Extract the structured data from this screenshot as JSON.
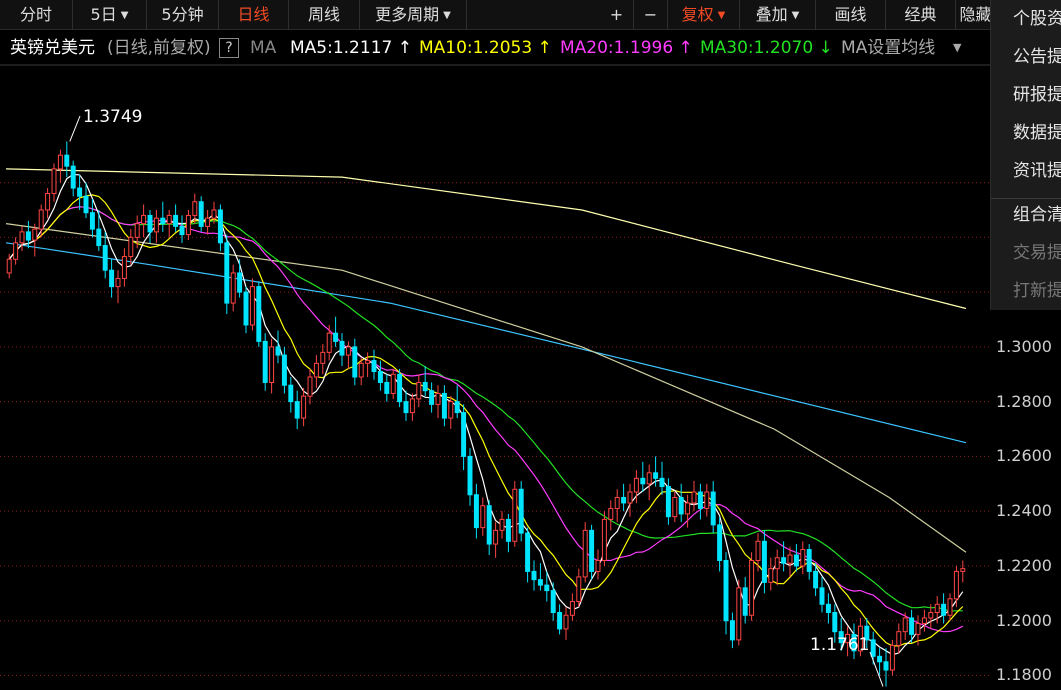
{
  "toolbar": {
    "left_buttons": [
      {
        "label": "分时",
        "x": 0,
        "w": 73,
        "active": false,
        "caret": false
      },
      {
        "label": "5日",
        "x": 73,
        "w": 74,
        "active": false,
        "caret": true
      },
      {
        "label": "5分钟",
        "x": 147,
        "w": 72,
        "active": false,
        "caret": false
      },
      {
        "label": "日线",
        "x": 219,
        "w": 70,
        "active": true,
        "caret": false
      },
      {
        "label": "周线",
        "x": 289,
        "w": 71,
        "active": false,
        "caret": false
      },
      {
        "label": "更多周期",
        "x": 360,
        "w": 107,
        "active": false,
        "caret": true
      }
    ],
    "right_buttons": [
      {
        "label": "+",
        "x": 600,
        "w": 34,
        "active": false,
        "caret": false
      },
      {
        "label": "−",
        "x": 634,
        "w": 34,
        "active": false,
        "caret": false
      },
      {
        "label": "复权",
        "x": 668,
        "w": 72,
        "active": true,
        "caret": true
      },
      {
        "label": "叠加",
        "x": 740,
        "w": 76,
        "active": false,
        "caret": true
      },
      {
        "label": "画线",
        "x": 816,
        "w": 70,
        "active": false,
        "caret": false
      },
      {
        "label": "经典",
        "x": 886,
        "w": 70,
        "active": false,
        "caret": false
      },
      {
        "label": "隐藏",
        "x": 956,
        "w": 40,
        "active": false,
        "caret": false
      }
    ]
  },
  "legend": {
    "title": "英镑兑美元",
    "subtitle": "(日线,前复权)",
    "help": "?",
    "ma_label": "MA",
    "items": [
      {
        "text": "MA5:1.2117",
        "arrow": "↑",
        "color": "#ffffff"
      },
      {
        "text": "MA10:1.2053",
        "arrow": "↑",
        "color": "#ffff00"
      },
      {
        "text": "MA20:1.1996",
        "arrow": "↑",
        "color": "#ff3cff"
      },
      {
        "text": "MA30:1.2070",
        "arrow": "↓",
        "color": "#22e022"
      }
    ],
    "settings": "MA设置均线"
  },
  "side_menu": {
    "items": [
      {
        "label": "个股资",
        "disabled": false
      },
      {
        "label": "公告提",
        "disabled": false
      },
      {
        "label": "研报提",
        "disabled": false
      },
      {
        "label": "数据提",
        "disabled": false
      },
      {
        "label": "资讯提",
        "disabled": false
      },
      {
        "label": "组合清",
        "disabled": false
      },
      {
        "label": "交易提",
        "disabled": true
      },
      {
        "label": "打新提",
        "disabled": true
      }
    ]
  },
  "colors": {
    "up": "#ff4545",
    "down": "#00e5ff",
    "ma5": "#ffffff",
    "ma10": "#ffff00",
    "ma20": "#ff3cff",
    "ma30": "#22e022",
    "ma60": "#cfcfa0",
    "ma120": "#3bc4ff",
    "ma250": "#ffffb0",
    "grid": "#8b1f1f"
  },
  "chart_data": {
    "type": "candlestick",
    "title": "英镑兑美元",
    "ylim": [
      1.1747,
      1.4033
    ],
    "yticks": [
      1.3,
      1.28,
      1.26,
      1.24,
      1.22,
      1.2,
      1.18
    ],
    "annotations": {
      "high": "1.3749",
      "low": "1.1761"
    },
    "candles": [
      [
        1.327,
        1.334,
        1.325,
        1.332
      ],
      [
        1.332,
        1.34,
        1.33,
        1.338
      ],
      [
        1.338,
        1.344,
        1.335,
        1.342
      ],
      [
        1.342,
        1.346,
        1.336,
        1.339
      ],
      [
        1.339,
        1.345,
        1.333,
        1.343
      ],
      [
        1.343,
        1.352,
        1.34,
        1.35
      ],
      [
        1.35,
        1.358,
        1.347,
        1.356
      ],
      [
        1.356,
        1.367,
        1.353,
        1.365
      ],
      [
        1.365,
        1.372,
        1.36,
        1.37
      ],
      [
        1.37,
        1.375,
        1.362,
        1.366
      ],
      [
        1.366,
        1.368,
        1.355,
        1.358
      ],
      [
        1.358,
        1.363,
        1.35,
        1.355
      ],
      [
        1.355,
        1.36,
        1.347,
        1.349
      ],
      [
        1.349,
        1.354,
        1.34,
        1.343
      ],
      [
        1.343,
        1.35,
        1.335,
        1.337
      ],
      [
        1.337,
        1.342,
        1.325,
        1.328
      ],
      [
        1.328,
        1.332,
        1.318,
        1.322
      ],
      [
        1.322,
        1.328,
        1.316,
        1.325
      ],
      [
        1.325,
        1.336,
        1.322,
        1.333
      ],
      [
        1.333,
        1.343,
        1.33,
        1.34
      ],
      [
        1.34,
        1.348,
        1.336,
        1.345
      ],
      [
        1.345,
        1.352,
        1.34,
        1.348
      ],
      [
        1.348,
        1.35,
        1.338,
        1.342
      ],
      [
        1.342,
        1.35,
        1.338,
        1.347
      ],
      [
        1.347,
        1.353,
        1.342,
        1.345
      ],
      [
        1.345,
        1.35,
        1.34,
        1.348
      ],
      [
        1.348,
        1.352,
        1.342,
        1.344
      ],
      [
        1.344,
        1.348,
        1.338,
        1.341
      ],
      [
        1.341,
        1.35,
        1.339,
        1.348
      ],
      [
        1.348,
        1.356,
        1.345,
        1.353
      ],
      [
        1.353,
        1.355,
        1.342,
        1.344
      ],
      [
        1.344,
        1.35,
        1.341,
        1.347
      ],
      [
        1.347,
        1.353,
        1.345,
        1.35
      ],
      [
        1.35,
        1.352,
        1.335,
        1.338
      ],
      [
        1.338,
        1.341,
        1.312,
        1.316
      ],
      [
        1.316,
        1.33,
        1.313,
        1.327
      ],
      [
        1.327,
        1.332,
        1.318,
        1.32
      ],
      [
        1.32,
        1.322,
        1.305,
        1.308
      ],
      [
        1.308,
        1.325,
        1.306,
        1.322
      ],
      [
        1.322,
        1.324,
        1.3,
        1.302
      ],
      [
        1.302,
        1.305,
        1.284,
        1.287
      ],
      [
        1.287,
        1.303,
        1.283,
        1.3
      ],
      [
        1.3,
        1.306,
        1.294,
        1.297
      ],
      [
        1.297,
        1.3,
        1.283,
        1.286
      ],
      [
        1.286,
        1.289,
        1.276,
        1.28
      ],
      [
        1.28,
        1.284,
        1.27,
        1.274
      ],
      [
        1.274,
        1.285,
        1.271,
        1.282
      ],
      [
        1.282,
        1.292,
        1.279,
        1.289
      ],
      [
        1.289,
        1.297,
        1.285,
        1.294
      ],
      [
        1.294,
        1.301,
        1.29,
        1.298
      ],
      [
        1.298,
        1.308,
        1.295,
        1.305
      ],
      [
        1.305,
        1.311,
        1.3,
        1.302
      ],
      [
        1.302,
        1.305,
        1.293,
        1.297
      ],
      [
        1.297,
        1.302,
        1.292,
        1.3
      ],
      [
        1.3,
        1.303,
        1.286,
        1.289
      ],
      [
        1.289,
        1.296,
        1.286,
        1.294
      ],
      [
        1.294,
        1.298,
        1.289,
        1.295
      ],
      [
        1.295,
        1.299,
        1.288,
        1.291
      ],
      [
        1.291,
        1.295,
        1.284,
        1.287
      ],
      [
        1.287,
        1.29,
        1.28,
        1.283
      ],
      [
        1.283,
        1.292,
        1.281,
        1.29
      ],
      [
        1.29,
        1.292,
        1.278,
        1.28
      ],
      [
        1.28,
        1.284,
        1.273,
        1.276
      ],
      [
        1.276,
        1.283,
        1.273,
        1.281
      ],
      [
        1.281,
        1.29,
        1.278,
        1.287
      ],
      [
        1.287,
        1.293,
        1.282,
        1.284
      ],
      [
        1.284,
        1.287,
        1.276,
        1.279
      ],
      [
        1.279,
        1.286,
        1.274,
        1.283
      ],
      [
        1.283,
        1.286,
        1.271,
        1.274
      ],
      [
        1.274,
        1.282,
        1.27,
        1.28
      ],
      [
        1.28,
        1.286,
        1.274,
        1.276
      ],
      [
        1.276,
        1.279,
        1.255,
        1.26
      ],
      [
        1.26,
        1.263,
        1.242,
        1.246
      ],
      [
        1.246,
        1.25,
        1.23,
        1.234
      ],
      [
        1.234,
        1.245,
        1.231,
        1.242
      ],
      [
        1.242,
        1.244,
        1.224,
        1.228
      ],
      [
        1.228,
        1.236,
        1.223,
        1.233
      ],
      [
        1.233,
        1.24,
        1.23,
        1.237
      ],
      [
        1.237,
        1.239,
        1.225,
        1.229
      ],
      [
        1.229,
        1.251,
        1.227,
        1.248
      ],
      [
        1.248,
        1.251,
        1.229,
        1.232
      ],
      [
        1.232,
        1.234,
        1.214,
        1.218
      ],
      [
        1.218,
        1.222,
        1.211,
        1.215
      ],
      [
        1.215,
        1.221,
        1.211,
        1.213
      ],
      [
        1.213,
        1.218,
        1.207,
        1.211
      ],
      [
        1.211,
        1.214,
        1.2,
        1.203
      ],
      [
        1.203,
        1.206,
        1.195,
        1.197
      ],
      [
        1.197,
        1.205,
        1.193,
        1.202
      ],
      [
        1.202,
        1.21,
        1.2,
        1.207
      ],
      [
        1.207,
        1.219,
        1.205,
        1.216
      ],
      [
        1.216,
        1.236,
        1.214,
        1.233
      ],
      [
        1.233,
        1.235,
        1.215,
        1.218
      ],
      [
        1.218,
        1.226,
        1.215,
        1.222
      ],
      [
        1.222,
        1.24,
        1.22,
        1.237
      ],
      [
        1.237,
        1.244,
        1.233,
        1.241
      ],
      [
        1.241,
        1.248,
        1.236,
        1.245
      ],
      [
        1.245,
        1.25,
        1.24,
        1.243
      ],
      [
        1.243,
        1.25,
        1.238,
        1.247
      ],
      [
        1.247,
        1.255,
        1.243,
        1.252
      ],
      [
        1.252,
        1.258,
        1.247,
        1.25
      ],
      [
        1.25,
        1.257,
        1.244,
        1.254
      ],
      [
        1.254,
        1.26,
        1.249,
        1.252
      ],
      [
        1.252,
        1.258,
        1.246,
        1.249
      ],
      [
        1.249,
        1.252,
        1.235,
        1.238
      ],
      [
        1.238,
        1.247,
        1.236,
        1.245
      ],
      [
        1.245,
        1.25,
        1.236,
        1.239
      ],
      [
        1.239,
        1.246,
        1.234,
        1.243
      ],
      [
        1.243,
        1.251,
        1.24,
        1.247
      ],
      [
        1.247,
        1.25,
        1.237,
        1.241
      ],
      [
        1.241,
        1.25,
        1.238,
        1.247
      ],
      [
        1.247,
        1.251,
        1.232,
        1.235
      ],
      [
        1.235,
        1.238,
        1.218,
        1.222
      ],
      [
        1.222,
        1.225,
        1.195,
        1.2
      ],
      [
        1.2,
        1.203,
        1.19,
        1.193
      ],
      [
        1.193,
        1.215,
        1.191,
        1.212
      ],
      [
        1.212,
        1.216,
        1.199,
        1.202
      ],
      [
        1.202,
        1.225,
        1.2,
        1.222
      ],
      [
        1.222,
        1.232,
        1.218,
        1.229
      ],
      [
        1.229,
        1.233,
        1.21,
        1.214
      ],
      [
        1.214,
        1.223,
        1.211,
        1.219
      ],
      [
        1.219,
        1.226,
        1.213,
        1.223
      ],
      [
        1.223,
        1.229,
        1.218,
        1.221
      ],
      [
        1.221,
        1.227,
        1.216,
        1.224
      ],
      [
        1.224,
        1.228,
        1.218,
        1.22
      ],
      [
        1.22,
        1.229,
        1.217,
        1.226
      ],
      [
        1.226,
        1.228,
        1.215,
        1.218
      ],
      [
        1.218,
        1.221,
        1.209,
        1.212
      ],
      [
        1.212,
        1.216,
        1.203,
        1.206
      ],
      [
        1.206,
        1.21,
        1.199,
        1.203
      ],
      [
        1.203,
        1.206,
        1.192,
        1.196
      ],
      [
        1.196,
        1.201,
        1.189,
        1.192
      ],
      [
        1.192,
        1.198,
        1.187,
        1.195
      ],
      [
        1.195,
        1.199,
        1.186,
        1.189
      ],
      [
        1.189,
        1.201,
        1.187,
        1.198
      ],
      [
        1.198,
        1.201,
        1.19,
        1.193
      ],
      [
        1.193,
        1.196,
        1.184,
        1.187
      ],
      [
        1.187,
        1.19,
        1.18,
        1.185
      ],
      [
        1.185,
        1.19,
        1.176,
        1.182
      ],
      [
        1.182,
        1.193,
        1.18,
        1.191
      ],
      [
        1.191,
        1.199,
        1.188,
        1.196
      ],
      [
        1.196,
        1.203,
        1.193,
        1.201
      ],
      [
        1.201,
        1.204,
        1.192,
        1.195
      ],
      [
        1.195,
        1.202,
        1.191,
        1.199
      ],
      [
        1.199,
        1.204,
        1.196,
        1.201
      ],
      [
        1.201,
        1.206,
        1.197,
        1.203
      ],
      [
        1.203,
        1.209,
        1.199,
        1.206
      ],
      [
        1.206,
        1.21,
        1.199,
        1.202
      ],
      [
        1.202,
        1.21,
        1.2,
        1.208
      ],
      [
        1.208,
        1.22,
        1.205,
        1.218
      ],
      [
        1.218,
        1.222,
        1.214,
        1.219
      ]
    ],
    "ma_long": {
      "ma60": [
        [
          1.345,
          0
        ],
        [
          1.328,
          0.35
        ],
        [
          1.3,
          0.6
        ],
        [
          1.27,
          0.8
        ],
        [
          1.245,
          0.92
        ],
        [
          1.225,
          1.0
        ]
      ],
      "ma120": [
        [
          1.338,
          0
        ],
        [
          1.33,
          0.15
        ],
        [
          1.316,
          0.4
        ],
        [
          1.295,
          0.65
        ],
        [
          1.265,
          1.0
        ]
      ],
      "ma250": [
        [
          1.365,
          0
        ],
        [
          1.362,
          0.35
        ],
        [
          1.35,
          0.6
        ],
        [
          1.33,
          0.82
        ],
        [
          1.314,
          1.0
        ]
      ]
    }
  }
}
